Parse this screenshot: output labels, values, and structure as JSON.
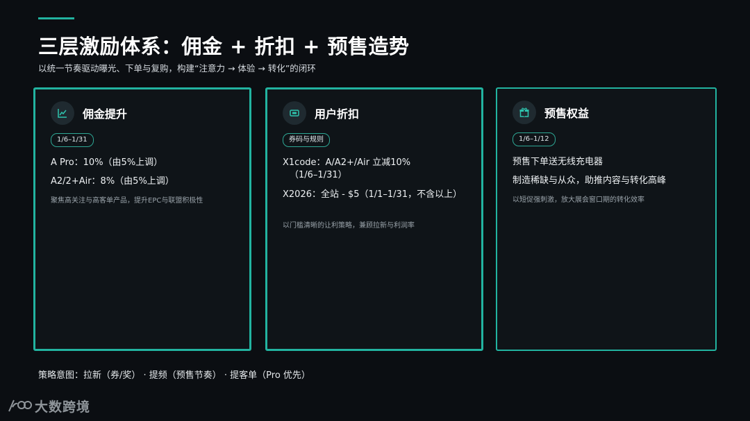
{
  "header": {
    "title": "三层激励体系：佣金 + 折扣 + 预售造势",
    "subtitle": "以统一节奏驱动曝光、下单与复购，构建“注意力 → 体验 → 转化”的闭环"
  },
  "cards": [
    {
      "icon": "trend-chart-icon",
      "title": "佣金提升",
      "badge": "1/6–1/31",
      "lines": [
        "A Pro：10%（由5%上调）",
        "A2/2+Air：8%（由5%上调）"
      ],
      "note": "聚焦高关注与高客单产品，提升EPC与联盟积极性"
    },
    {
      "icon": "ticket-icon",
      "title": "用户折扣",
      "badge": "券码与规则",
      "lines": [
        "X1code：A/A2+/Air 立减10%",
        "（1/6–1/31）",
        "X2026：全站 - $5（1/1–1/31，不含以上）"
      ],
      "note": "以门槛清晰的让利策略，兼顾拉新与利润率"
    },
    {
      "icon": "gift-icon",
      "title": "预售权益",
      "badge": "1/6–1/12",
      "lines": [
        "预售下单送无线充电器",
        "制造稀缺与从众，助推内容与转化高峰"
      ],
      "note": "以短促强刺激，放大展会窗口期的转化效率"
    }
  ],
  "footer": {
    "strategy": "策略意图：拉新（券/奖）  · 提频（预售节奏）  · 提客单（Pro 优先）",
    "logo_text": "大数跨境"
  },
  "colors": {
    "background": "#0b0e12",
    "accent": "#22b3a0",
    "card_background": "#0f1418"
  }
}
